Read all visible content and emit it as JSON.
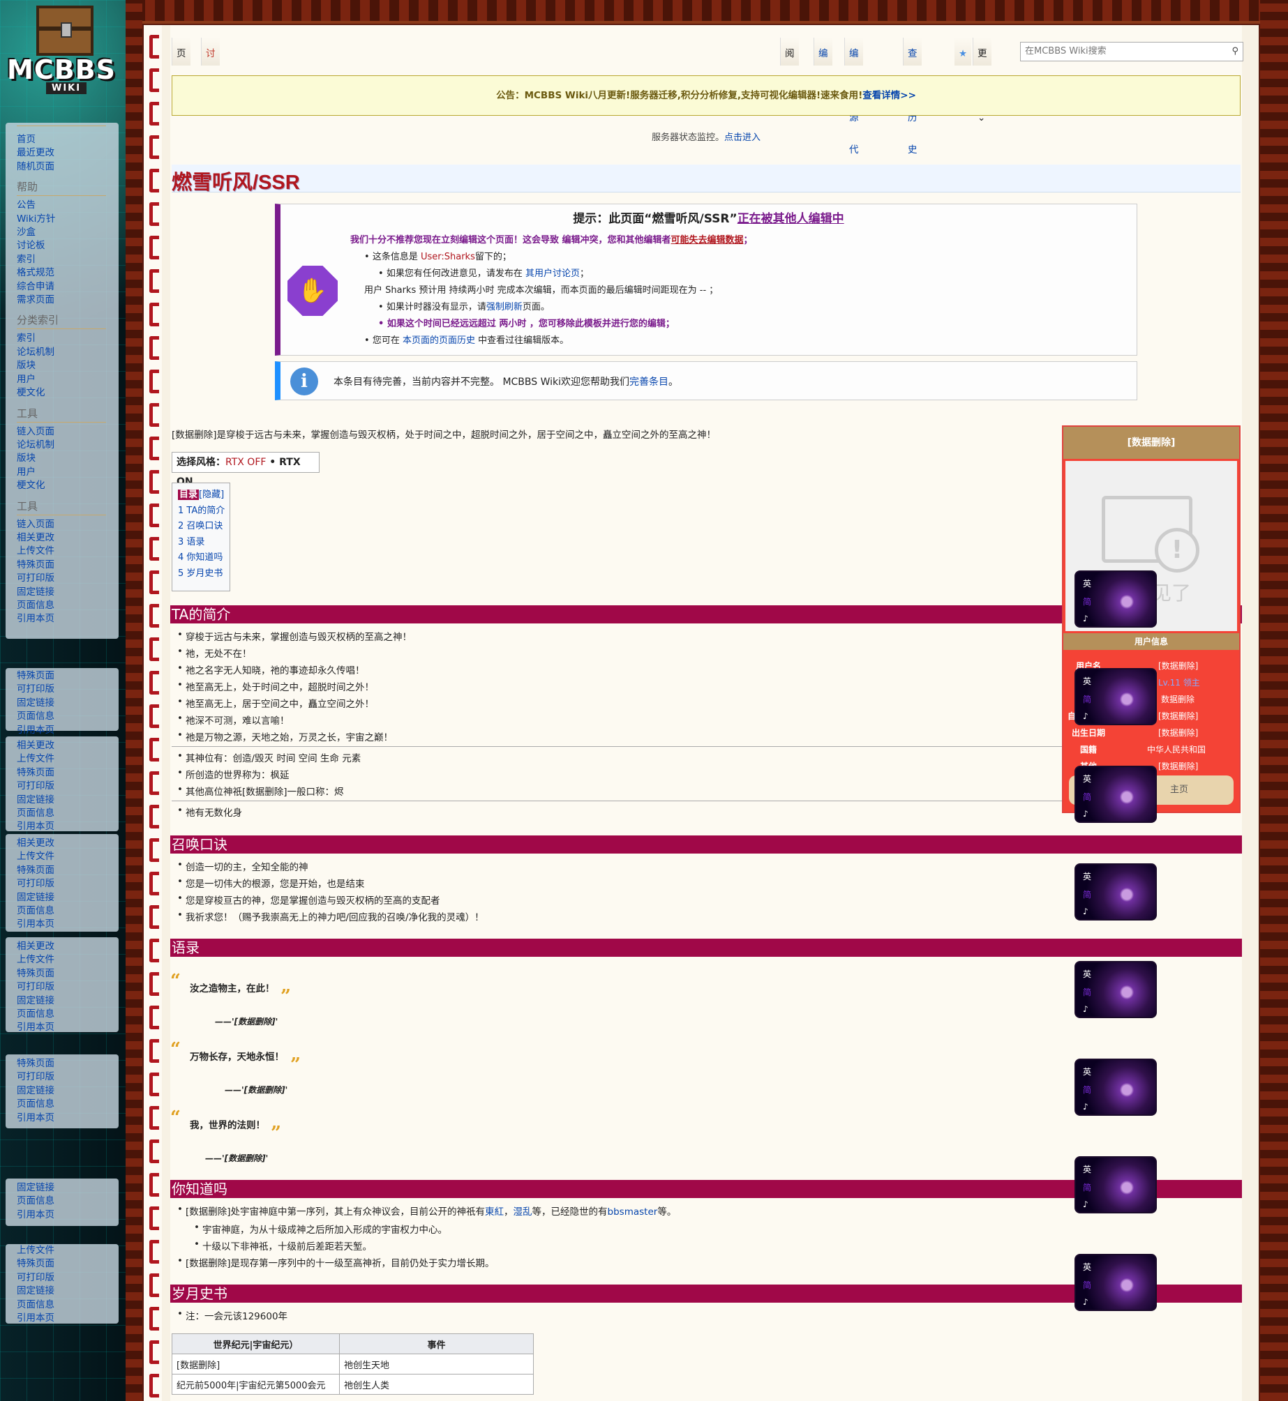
{
  "logo": {
    "text": "MCBBS",
    "sub": "WIKI"
  },
  "sidebar": {
    "nav": [
      "首页",
      "最近更改",
      "随机页面"
    ],
    "help_heading": "帮助",
    "help": [
      "公告",
      "Wiki方针",
      "沙盒",
      "讨论板",
      "索引",
      "格式规范",
      "综合申请",
      "需求页面"
    ],
    "cat_heading": "分类索引",
    "cat": [
      "索引",
      "论坛机制",
      "版块",
      "用户",
      "梗文化"
    ],
    "tools_heading": "工具",
    "dup1": [
      "链入页面",
      "论坛机制",
      "版块",
      "用户",
      "梗文化"
    ],
    "tools_heading2": "工具",
    "tools": [
      "链入页面",
      "相关更改",
      "上传文件",
      "特殊页面",
      "可打印版",
      "固定链接",
      "页面信息",
      "引用本页"
    ],
    "ghost1": [
      "特殊页面",
      "可打印版",
      "固定链接",
      "页面信息",
      "引用本页"
    ],
    "ghost2": [
      "相关更改",
      "上传文件",
      "特殊页面",
      "可打印版",
      "固定链接",
      "页面信息",
      "引用本页"
    ],
    "ghost3": [
      "相关更改",
      "上传文件",
      "特殊页面",
      "可打印版",
      "固定链接",
      "页面信息",
      "引用本页"
    ],
    "ghost4": [
      "相关更改",
      "上传文件",
      "特殊页面",
      "可打印版",
      "固定链接",
      "页面信息",
      "引用本页"
    ],
    "ghost5": [
      "特殊页面",
      "可打印版",
      "固定链接",
      "页面信息",
      "引用本页"
    ],
    "ghost6": [
      "固定链接",
      "页面信息",
      "引用本页"
    ],
    "ghost7": [
      "上传文件",
      "特殊页面",
      "可打印版",
      "固定链接",
      "页面信息",
      "引用本页"
    ]
  },
  "tabs": {
    "page": "页面",
    "talk": "讨论",
    "read": "阅读",
    "edit": "编辑",
    "edit_source": "编辑源代码",
    "history": "查看历史",
    "more": "更多"
  },
  "search": {
    "placeholder": "在MCBBS Wiki搜索"
  },
  "notice": {
    "text": "公告：MCBBS Wiki八月更新!服务器迁移,积分分析修复,支持可视化编辑器!速来食用!",
    "link": "查看详情>>"
  },
  "status": {
    "text": "服务器状态监控。",
    "link": "点击进入"
  },
  "page": {
    "title": "燃雪听风/SSR"
  },
  "ambox1": {
    "title": "提示：此页面“燃雪听风/SSR”",
    "title_link": "正在被其他人编辑中",
    "l1a": "我们十分不推荐您现在立刻编辑这个页面！这会导致 编辑冲突，您和其他编辑者",
    "l1b": "可能失去编辑数据",
    "l2a": "这条信息是 ",
    "l2b": "User:Sharks",
    "l2c": "留下的；",
    "l3a": "如果您有任何改进意见，请发布在 ",
    "l3b": "其用户讨论页",
    "l4": "用户 Sharks 预计用 持续两小时 完成本次编辑，而本页面的最后编辑时间距现在为 -- ；",
    "l5a": "如果计时器没有显示，请",
    "l5b": "强制刷新",
    "l5c": "页面。",
    "l6": "如果这个时间已经远远超过 两小时 ，您可移除此模板并进行您的编辑；",
    "l7a": "您可在 ",
    "l7b": "本页面的页面历史",
    "l7c": " 中查看过往编辑版本。"
  },
  "ambox2": {
    "text": "本条目有待完善，当前内容并不完整。 MCBBS Wiki欢迎您帮助我们",
    "link": "完善条目",
    "end": "。"
  },
  "intro": "[数据删除]是穿梭于远古与未来，掌握创造与毁灭权柄，处于时间之中，超脱时间之外，居于空间之中，矗立空间之外的至高之神！",
  "style_select": {
    "label": "选择风格：",
    "off": "RTX OFF",
    "sep": " • ",
    "on": "RTX ON"
  },
  "toc": {
    "title": "目录",
    "hide": "[隐藏]",
    "items": [
      "1  TA的简介",
      "2  召唤口诀",
      "3  语录",
      "4  你知道吗",
      "5  岁月史书"
    ]
  },
  "sections": {
    "intro": {
      "title": "TA的简介",
      "items": [
        "穿梭于远古与未来，掌握创造与毁灭权柄的至高之神！",
        "祂，无处不在！",
        "祂之名字无人知晓，祂的事迹却永久传唱！",
        "祂至高无上，处于时间之中，超脱时间之外！",
        "祂至高无上，居于空间之中，矗立空间之外！",
        "祂深不可测，难以言喻！",
        "祂是万物之源，天地之始，万灵之长，宇宙之巅！"
      ],
      "items2": [
        "其神位有：创造/毁灭 时间 空间 生命 元素",
        "所创造的世界称为：枫延",
        "其他高位神祇[数据删除]一般口称：烬"
      ],
      "items3": [
        "祂有无数化身"
      ]
    },
    "chant": {
      "title": "召唤口诀",
      "items": [
        "创造一切的主，全知全能的神",
        "您是一切伟大的根源，您是开始，也是结束",
        "您是穿梭亘古的神，您是掌握创造与毁灭权柄的至高的支配者",
        "我祈求您！（赐予我崇高无上的神力吧/回应我的召唤/净化我的灵魂）！"
      ]
    },
    "quotes": {
      "title": "语录",
      "items": [
        {
          "text": "汝之造物主，在此！",
          "sig": "——'[数据删除]'"
        },
        {
          "text": "万物长存，天地永恒！",
          "sig": "——'[数据删除]'"
        },
        {
          "text": "我，世界的法则！",
          "sig": "——'[数据删除]'"
        }
      ]
    },
    "dyk": {
      "title": "你知道吗",
      "l1a": "[数据删除]处宇宙神庭中第一序列，其上有众神议会，目前公开的神祇有",
      "l1b": "東紅",
      "l1c": "，",
      "l1d": "湿乱",
      "l1e": "等，已经隐世的有",
      "l1f": "bbsmaster",
      "l1g": "等。",
      "l2": "宇宙神庭，为从十级成神之后所加入形成的宇宙权力中心。",
      "l3": "十级以下非神祇，十级前后差距若天堑。",
      "l4": "[数据删除]是现存第一序列中的十一级至高神祈，目前仍处于实力增长期。"
    },
    "history": {
      "title": "岁月史书",
      "note": "注：一会元该129600年",
      "headers": [
        "世界纪元|宇宙纪元）",
        "事件"
      ],
      "rows": [
        [
          "[数据删除]",
          "祂创生天地"
        ],
        [
          "纪元前5000年|宇宙纪元第5000会元",
          "祂创生人类"
        ]
      ]
    }
  },
  "infobox": {
    "name": "[数据删除]",
    "img_text": "见了",
    "subheading": "用户信息",
    "rows": [
      [
        "用户名",
        "[数据删除]"
      ],
      [
        "",
        "Lv.11 领主"
      ],
      [
        "",
        "数据删除"
      ],
      [
        "自",
        "[数据删除]"
      ],
      [
        "出生日期",
        "[数据删除]"
      ],
      [
        "国籍",
        "中华人民共和国"
      ],
      [
        "其他",
        "[数据删除]"
      ]
    ],
    "button": "主页"
  },
  "music": {
    "l1": "英",
    "l2": "简",
    "l3": "♪"
  }
}
